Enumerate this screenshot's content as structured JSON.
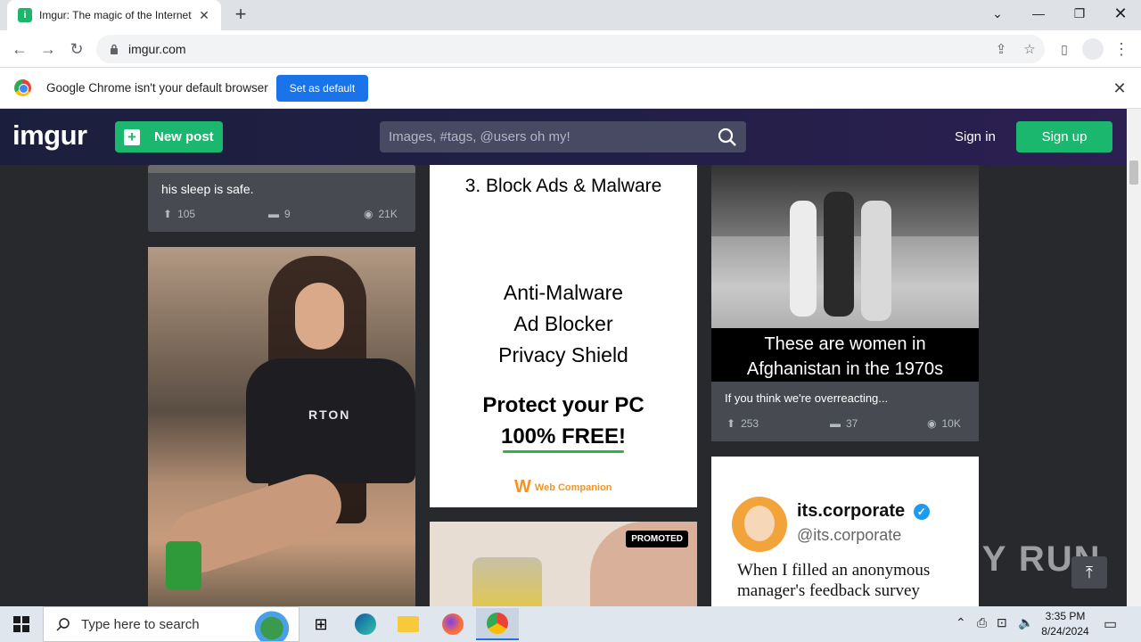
{
  "browser": {
    "tab_title": "Imgur: The magic of the Internet",
    "url": "imgur.com",
    "infobar_text": "Google Chrome isn't your default browser",
    "set_default_label": "Set as default"
  },
  "header": {
    "logo": "imgur",
    "new_post_label": "New post",
    "search_placeholder": "Images, #tags, @users oh my!",
    "sign_in_label": "Sign in",
    "sign_up_label": "Sign up"
  },
  "posts": {
    "top_left": {
      "title": "his sleep is safe.",
      "upvotes": "105",
      "comments": "9",
      "views": "21K"
    },
    "woman_photo": {
      "shirt_text": "RTON"
    },
    "ad": {
      "headline": "3. Block Ads & Malware",
      "features": [
        "Anti-Malware",
        "Ad Blocker",
        "Privacy Shield"
      ],
      "protect": "Protect your PC",
      "free": "100% FREE!",
      "brand": "Web Companion"
    },
    "promoted": {
      "badge": "PROMOTED"
    },
    "afghan": {
      "caption_line1": "These are women in",
      "caption_line2": "Afghanistan in the 1970s",
      "title": "If you think we're overreacting...",
      "upvotes": "253",
      "comments": "37",
      "views": "10K"
    },
    "tweet": {
      "name": "its.corporate",
      "handle": "@its.corporate",
      "text_line1": "When I filled an anonymous",
      "text_line2": "manager's feedback survey"
    }
  },
  "watermark": "ANY RUN",
  "taskbar": {
    "search_placeholder": "Type here to search",
    "time": "3:35 PM",
    "date": "8/24/2024"
  }
}
